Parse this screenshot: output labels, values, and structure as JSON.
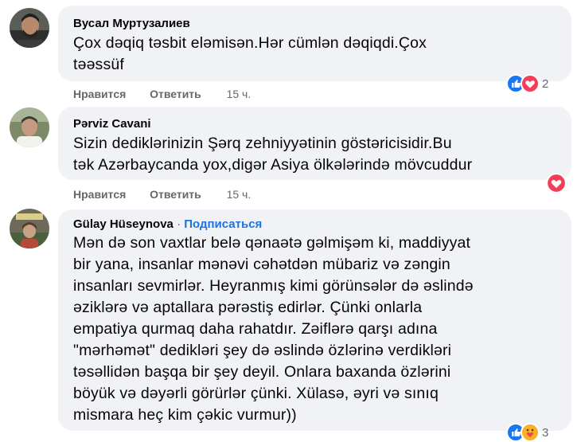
{
  "comments": [
    {
      "author": "Вусал Муртузалиев",
      "lines": [
        "Çox dəqiq təsbit eləmisən.Hər cümlən dəqiqdi.Çox",
        "təəssüf"
      ],
      "like_label": "Нравится",
      "reply_label": "Ответить",
      "time": "15 ч.",
      "reactions": [
        "like-icon",
        "love-icon"
      ],
      "reaction_count": "2"
    },
    {
      "author": "Pərviz Cavani",
      "lines": [
        "Sizin dediklərinizin Şərq zehniyyətinin göstəricisidir.Bu",
        "tək Azərbaycanda yox,digər Asiya ölkələrində mövcuddur"
      ],
      "like_label": "Нравится",
      "reply_label": "Ответить",
      "time": "15 ч.",
      "reactions": [
        "love-icon"
      ]
    },
    {
      "author": "Gülay Hüseynova",
      "separator": "·",
      "follow_label": "Подписаться",
      "lines": [
        "Mən də son vaxtlar belə qənaətə gəlmişəm ki, maddiyyat",
        "bir yana, insanlar mənəvi cəhətdən mübariz və zəngin",
        "insanları sevmirlər. Heyranmış kimi görünsələr də əslində",
        "əziklərə və aptallara pərəstiş edirlər. Çünki onlarla",
        "empatiya qurmaq daha rahatdır. Zəiflərə qarşı adına",
        "\"mərhəmət\" dedikləri şey də əslində özlərinə verdikləri",
        "təsəllidən başqa bir şey deyil. Onlara baxanda özlərini",
        "böyük və dəyərli görürlər çünki. Xülasə, əyri və sınıq",
        "mismara heç kim çəkic vurmur))"
      ],
      "reactions": [
        "like-icon",
        "care-icon"
      ],
      "reaction_count": "3"
    }
  ],
  "colors": {
    "bubble": "#f0f2f5",
    "like_blue": "#1877f2",
    "love_red": "#f33e58",
    "care_yellow": "#f7b125",
    "link_blue": "#1b74e4",
    "meta_gray": "#65676b"
  }
}
